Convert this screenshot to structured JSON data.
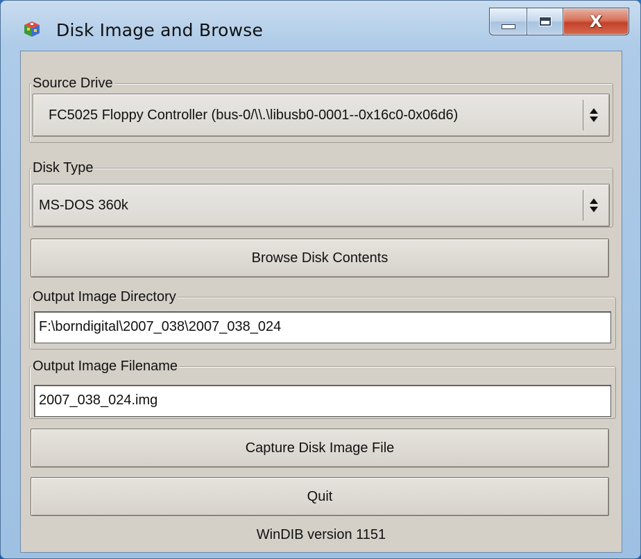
{
  "window": {
    "title": "Disk Image and Browse",
    "icon": "app-cube-icon",
    "controls": {
      "minimize": "minimize-icon",
      "maximize": "maximize-icon",
      "close_label": "X"
    }
  },
  "source_drive": {
    "legend": "Source Drive",
    "value": "FC5025 Floppy Controller (bus-0/\\\\.\\libusb0-0001--0x16c0-0x06d6)"
  },
  "disk_type": {
    "legend": "Disk Type",
    "value": "MS-DOS 360k"
  },
  "browse_button": "Browse Disk Contents",
  "output_directory": {
    "legend": "Output Image Directory",
    "value": "F:\\borndigital\\2007_038\\2007_038_024"
  },
  "output_filename": {
    "legend": "Output Image Filename",
    "value": "2007_038_024.img"
  },
  "capture_button": "Capture Disk Image File",
  "quit_button": "Quit",
  "version_text": "WinDIB version 1151",
  "colors": {
    "client_bg": "#d4d0c8",
    "close_button": "#c2422a",
    "frame": "#aecbe8"
  }
}
